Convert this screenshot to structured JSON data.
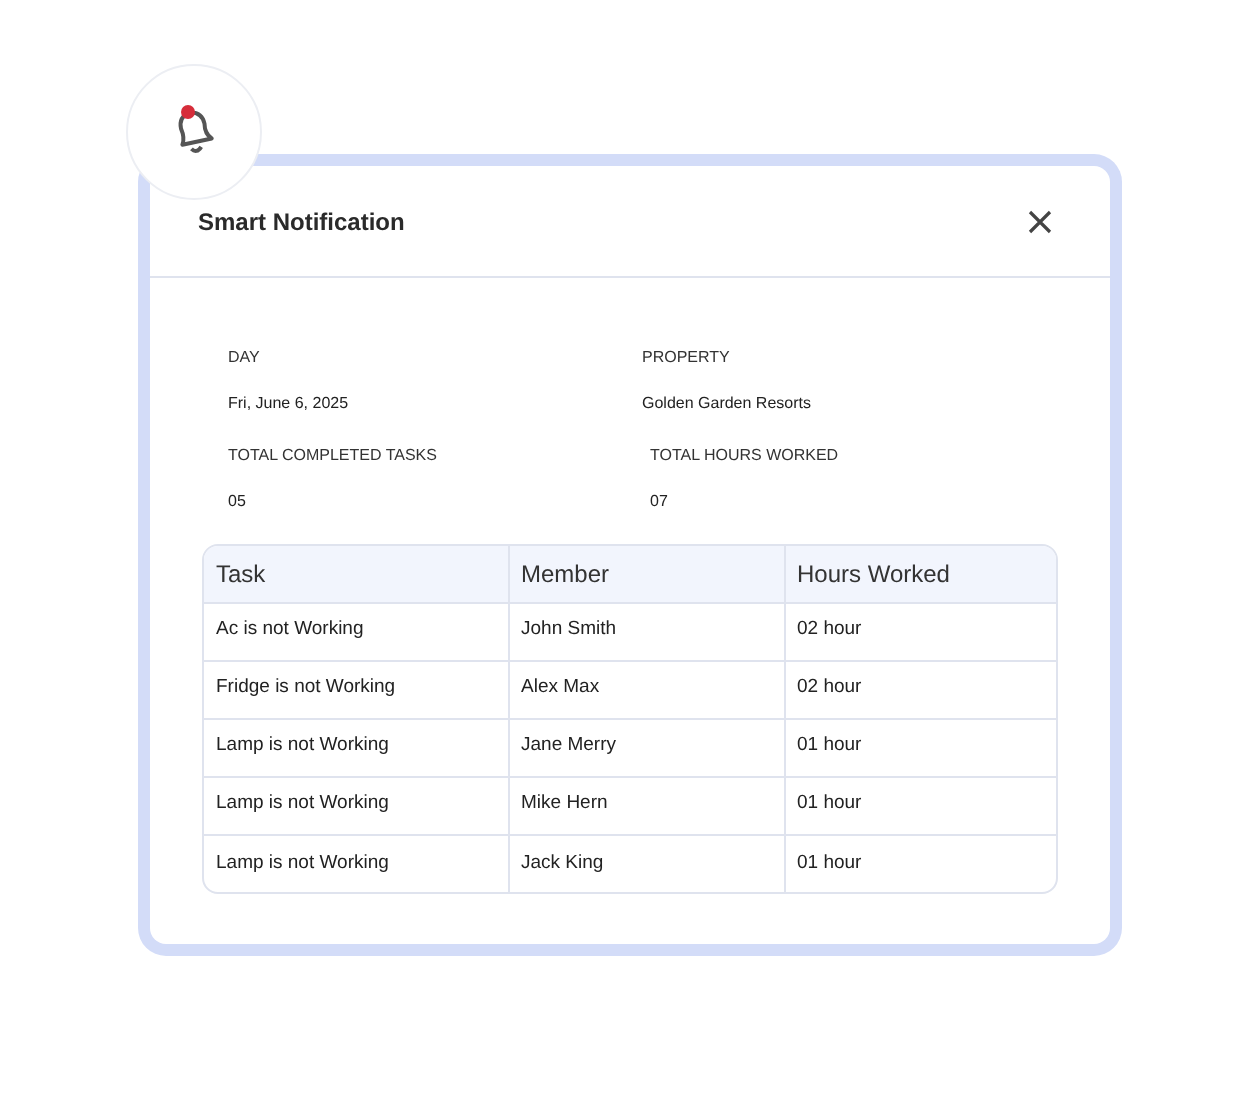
{
  "dialog": {
    "title": "Smart Notification",
    "unread": true
  },
  "summary": [
    {
      "label": "DAY",
      "value": "Fri, June 6, 2025"
    },
    {
      "label": "PROPERTY",
      "value": "Golden Garden Resorts"
    },
    {
      "label": "TOTAL COMPLETED TASKS",
      "value": "05"
    },
    {
      "label": "TOTAL HOURS WORKED",
      "value": "07"
    }
  ],
  "table": {
    "columns": [
      "Task",
      "Member",
      "Hours Worked"
    ],
    "rows": [
      [
        "Ac is not Working",
        "John Smith",
        "02 hour"
      ],
      [
        "Fridge is not Working",
        "Alex Max",
        "02 hour"
      ],
      [
        "Lamp is not Working",
        "Jane Merry",
        "01 hour"
      ],
      [
        "Lamp is not Working",
        "Mike Hern",
        "01 hour"
      ],
      [
        "Lamp is not Working",
        "Jack King",
        "01 hour"
      ]
    ]
  }
}
